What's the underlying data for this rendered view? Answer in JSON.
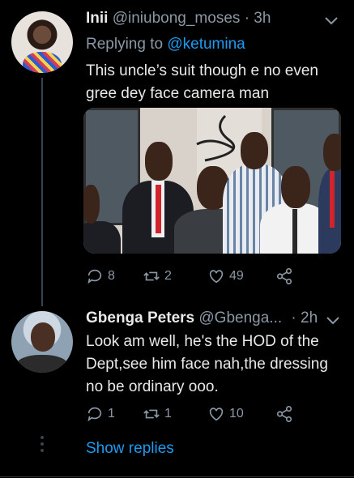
{
  "tweet1": {
    "name": "Inii",
    "handle": "@iniubong_moses",
    "time": "· 3h",
    "replying_prefix": "Replying to",
    "replying_handle": "@ketumina",
    "text_line1": "This uncle’s suit though e no even",
    "text_line2": "gree dey face camera man",
    "stats": {
      "replies": "8",
      "retweets": "2",
      "likes": "49"
    }
  },
  "tweet2": {
    "name": "Gbenga Peters",
    "handle": "@Gbenga...",
    "time": "· 2h",
    "text_line1": "Look am well, he's the HOD of the",
    "text_line2": "Dept,see him face nah,the dressing",
    "text_line3": "no be ordinary ooo.",
    "stats": {
      "replies": "1",
      "retweets": "1",
      "likes": "10"
    }
  },
  "show_replies": "Show replies",
  "icons": {
    "reply": "reply-icon",
    "retweet": "retweet-icon",
    "like": "heart-icon",
    "share": "share-icon",
    "more": "chevron-down-icon"
  },
  "colors": {
    "background": "#000000",
    "link": "#1d9bf0",
    "muted": "#8b98a5",
    "text": "#e7e9ea"
  }
}
